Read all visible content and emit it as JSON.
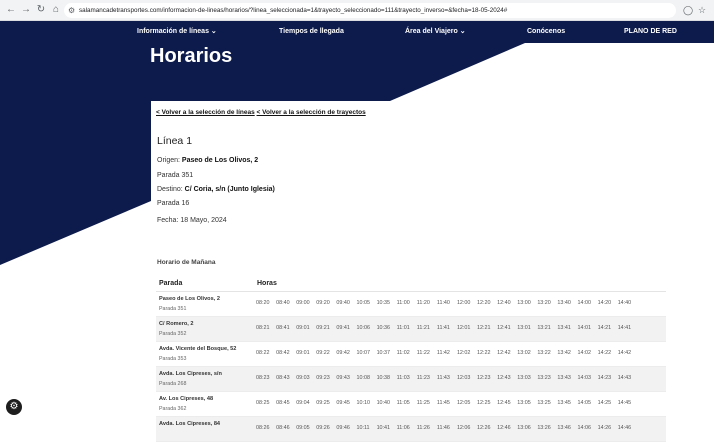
{
  "browser": {
    "url": "salamancadetransportes.com/informacion-de-lineas/horarios/?linea_seleccionada=1&trayecto_seleccionado=111&trayecto_inverso=&fecha=18-05-2024#"
  },
  "nav": {
    "items": [
      "Información de líneas",
      "Tiempos de llegada",
      "Área del Viajero",
      "Conócenos",
      "PLANO DE RED"
    ]
  },
  "page": {
    "title": "Horarios",
    "back_lines": "< Volver a la selección de líneas",
    "back_trips": "< Volver a la selección de trayectos",
    "linea": "Línea 1",
    "origen_label": "Origen:",
    "origen_value": "Paseo de Los Olivos, 2",
    "parada_origen": "Parada 351",
    "destino_label": "Destino:",
    "destino_value": "C/ Coria, s/n (Junto Iglesia)",
    "parada_destino": "Parada 16",
    "fecha": "Fecha: 18 Mayo, 2024",
    "section": "Horario de Mañana"
  },
  "table": {
    "headers": [
      "Parada",
      "Horas"
    ],
    "rows": [
      {
        "stop": "Paseo de Los Olivos, 2",
        "code": "Parada 351",
        "times": [
          "08:20",
          "08:40",
          "09:00",
          "09:20",
          "09:40",
          "10:05",
          "10:35",
          "11:00",
          "11:20",
          "11:40",
          "12:00",
          "12:20",
          "12:40",
          "13:00",
          "13:20",
          "13:40",
          "14:00",
          "14:20",
          "14:40"
        ]
      },
      {
        "stop": "C/ Romero, 2",
        "code": "Parada 352",
        "times": [
          "08:21",
          "08:41",
          "09:01",
          "09:21",
          "09:41",
          "10:06",
          "10:36",
          "11:01",
          "11:21",
          "11:41",
          "12:01",
          "12:21",
          "12:41",
          "13:01",
          "13:21",
          "13:41",
          "14:01",
          "14:21",
          "14:41"
        ]
      },
      {
        "stop": "Avda. Vicente del Bosque, 52",
        "code": "Parada 353",
        "times": [
          "08:22",
          "08:42",
          "09:01",
          "09:22",
          "09:42",
          "10:07",
          "10:37",
          "11:02",
          "11:22",
          "11:42",
          "12:02",
          "12:22",
          "12:42",
          "13:02",
          "13:22",
          "13:42",
          "14:02",
          "14:22",
          "14:42"
        ]
      },
      {
        "stop": "Avda. Los Cipreses, s/n",
        "code": "Parada 268",
        "times": [
          "08:23",
          "08:43",
          "09:03",
          "09:23",
          "09:43",
          "10:08",
          "10:38",
          "11:03",
          "11:23",
          "11:43",
          "12:03",
          "12:23",
          "12:43",
          "13:03",
          "13:23",
          "13:43",
          "14:03",
          "14:23",
          "14:43"
        ]
      },
      {
        "stop": "Av. Los Cipreses, 48",
        "code": "Parada 362",
        "times": [
          "08:25",
          "08:45",
          "09:04",
          "09:25",
          "09:45",
          "10:10",
          "10:40",
          "11:05",
          "11:25",
          "11:45",
          "12:05",
          "12:25",
          "12:45",
          "13:05",
          "13:25",
          "13:45",
          "14:05",
          "14:25",
          "14:45"
        ]
      },
      {
        "stop": "Avda. Los Cipreses, 84",
        "code": "",
        "times": [
          "08:26",
          "08:46",
          "09:05",
          "09:26",
          "09:46",
          "10:11",
          "10:41",
          "11:06",
          "11:26",
          "11:46",
          "12:06",
          "12:26",
          "12:46",
          "13:06",
          "13:26",
          "13:46",
          "14:06",
          "14:26",
          "14:46"
        ]
      }
    ]
  },
  "colors": {
    "navy": "#0d1b4c",
    "row_alt": "#f2f2f2"
  }
}
